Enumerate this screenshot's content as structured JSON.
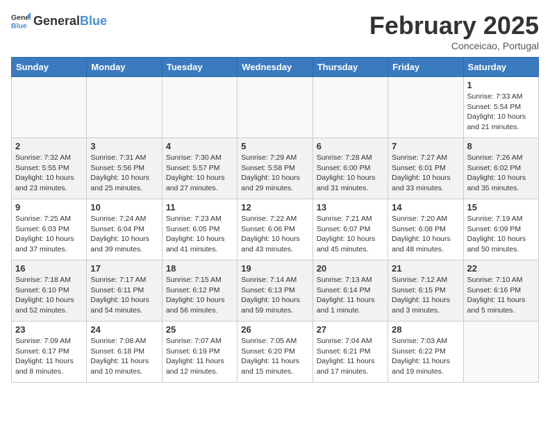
{
  "logo": {
    "general": "General",
    "blue": "Blue"
  },
  "title": "February 2025",
  "subtitle": "Conceicao, Portugal",
  "days_of_week": [
    "Sunday",
    "Monday",
    "Tuesday",
    "Wednesday",
    "Thursday",
    "Friday",
    "Saturday"
  ],
  "weeks": [
    [
      {
        "day": "",
        "info": ""
      },
      {
        "day": "",
        "info": ""
      },
      {
        "day": "",
        "info": ""
      },
      {
        "day": "",
        "info": ""
      },
      {
        "day": "",
        "info": ""
      },
      {
        "day": "",
        "info": ""
      },
      {
        "day": "1",
        "info": "Sunrise: 7:33 AM\nSunset: 5:54 PM\nDaylight: 10 hours\nand 21 minutes."
      }
    ],
    [
      {
        "day": "2",
        "info": "Sunrise: 7:32 AM\nSunset: 5:55 PM\nDaylight: 10 hours\nand 23 minutes."
      },
      {
        "day": "3",
        "info": "Sunrise: 7:31 AM\nSunset: 5:56 PM\nDaylight: 10 hours\nand 25 minutes."
      },
      {
        "day": "4",
        "info": "Sunrise: 7:30 AM\nSunset: 5:57 PM\nDaylight: 10 hours\nand 27 minutes."
      },
      {
        "day": "5",
        "info": "Sunrise: 7:29 AM\nSunset: 5:58 PM\nDaylight: 10 hours\nand 29 minutes."
      },
      {
        "day": "6",
        "info": "Sunrise: 7:28 AM\nSunset: 6:00 PM\nDaylight: 10 hours\nand 31 minutes."
      },
      {
        "day": "7",
        "info": "Sunrise: 7:27 AM\nSunset: 6:01 PM\nDaylight: 10 hours\nand 33 minutes."
      },
      {
        "day": "8",
        "info": "Sunrise: 7:26 AM\nSunset: 6:02 PM\nDaylight: 10 hours\nand 35 minutes."
      }
    ],
    [
      {
        "day": "9",
        "info": "Sunrise: 7:25 AM\nSunset: 6:03 PM\nDaylight: 10 hours\nand 37 minutes."
      },
      {
        "day": "10",
        "info": "Sunrise: 7:24 AM\nSunset: 6:04 PM\nDaylight: 10 hours\nand 39 minutes."
      },
      {
        "day": "11",
        "info": "Sunrise: 7:23 AM\nSunset: 6:05 PM\nDaylight: 10 hours\nand 41 minutes."
      },
      {
        "day": "12",
        "info": "Sunrise: 7:22 AM\nSunset: 6:06 PM\nDaylight: 10 hours\nand 43 minutes."
      },
      {
        "day": "13",
        "info": "Sunrise: 7:21 AM\nSunset: 6:07 PM\nDaylight: 10 hours\nand 45 minutes."
      },
      {
        "day": "14",
        "info": "Sunrise: 7:20 AM\nSunset: 6:08 PM\nDaylight: 10 hours\nand 48 minutes."
      },
      {
        "day": "15",
        "info": "Sunrise: 7:19 AM\nSunset: 6:09 PM\nDaylight: 10 hours\nand 50 minutes."
      }
    ],
    [
      {
        "day": "16",
        "info": "Sunrise: 7:18 AM\nSunset: 6:10 PM\nDaylight: 10 hours\nand 52 minutes."
      },
      {
        "day": "17",
        "info": "Sunrise: 7:17 AM\nSunset: 6:11 PM\nDaylight: 10 hours\nand 54 minutes."
      },
      {
        "day": "18",
        "info": "Sunrise: 7:15 AM\nSunset: 6:12 PM\nDaylight: 10 hours\nand 56 minutes."
      },
      {
        "day": "19",
        "info": "Sunrise: 7:14 AM\nSunset: 6:13 PM\nDaylight: 10 hours\nand 59 minutes."
      },
      {
        "day": "20",
        "info": "Sunrise: 7:13 AM\nSunset: 6:14 PM\nDaylight: 11 hours\nand 1 minute."
      },
      {
        "day": "21",
        "info": "Sunrise: 7:12 AM\nSunset: 6:15 PM\nDaylight: 11 hours\nand 3 minutes."
      },
      {
        "day": "22",
        "info": "Sunrise: 7:10 AM\nSunset: 6:16 PM\nDaylight: 11 hours\nand 5 minutes."
      }
    ],
    [
      {
        "day": "23",
        "info": "Sunrise: 7:09 AM\nSunset: 6:17 PM\nDaylight: 11 hours\nand 8 minutes."
      },
      {
        "day": "24",
        "info": "Sunrise: 7:08 AM\nSunset: 6:18 PM\nDaylight: 11 hours\nand 10 minutes."
      },
      {
        "day": "25",
        "info": "Sunrise: 7:07 AM\nSunset: 6:19 PM\nDaylight: 11 hours\nand 12 minutes."
      },
      {
        "day": "26",
        "info": "Sunrise: 7:05 AM\nSunset: 6:20 PM\nDaylight: 11 hours\nand 15 minutes."
      },
      {
        "day": "27",
        "info": "Sunrise: 7:04 AM\nSunset: 6:21 PM\nDaylight: 11 hours\nand 17 minutes."
      },
      {
        "day": "28",
        "info": "Sunrise: 7:03 AM\nSunset: 6:22 PM\nDaylight: 11 hours\nand 19 minutes."
      },
      {
        "day": "",
        "info": ""
      }
    ]
  ]
}
